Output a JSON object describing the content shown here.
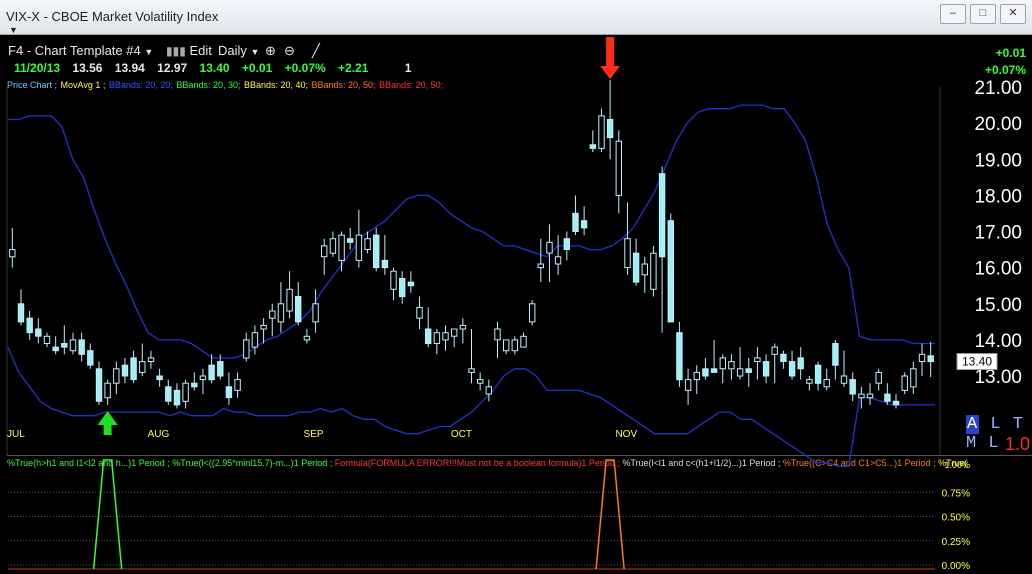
{
  "window": {
    "title": "VIX-X  -  CBOE Market Volatility Index"
  },
  "toolbar": {
    "template": "F4 - Chart Template #4",
    "edit": "Edit",
    "period": "Daily"
  },
  "quote": {
    "date": "11/20/13",
    "open": "13.56",
    "high": "13.94",
    "low": "12.97",
    "close": "13.40",
    "change": "+0.01",
    "pct": "+0.07%",
    "extra": "+2.21",
    "count": "1"
  },
  "right_change": {
    "abs": "+0.01",
    "pct": "+0.07%"
  },
  "price_tag": "13.40",
  "legend": [
    {
      "text": "Price Chart ; ",
      "color": "#66ccff"
    },
    {
      "text": "MovAvg 1 ; ",
      "color": "#ffff33"
    },
    {
      "text": "BBands: 20, 20; ",
      "color": "#3355ff"
    },
    {
      "text": "BBands: 20, 30; ",
      "color": "#33ff33"
    },
    {
      "text": "BBands: 20, 40; ",
      "color": "#ffff33"
    },
    {
      "text": "BBands: 20, 50; ",
      "color": "#ff7722"
    },
    {
      "text": "BBands: 20, 50; ",
      "color": "#ff3333"
    }
  ],
  "indicators": [
    {
      "text": "%True(h>h1 and l1<l2 and h...)1 Period ; ",
      "color": "#33ff33"
    },
    {
      "text": "%True(l<((2.95*minl15.7)-m...)1 Period ; ",
      "color": "#33ff33"
    },
    {
      "text": "Formula(FORMULA ERROR!!!Must not be a boolean formula)1 Period ; ",
      "color": "#ff3333"
    },
    {
      "text": "%True(l<l1 and c<(h1+l1/2)...)1 Period ; ",
      "color": "#dddddd"
    },
    {
      "text": "%True((C>C4 and C1>C5...)1 Period ; ",
      "color": "#ff7722"
    },
    {
      "text": "%True(",
      "color": "#ffff33"
    }
  ],
  "alt_label": {
    "a": "A",
    "rest": "L T M L"
  },
  "value_1_0": "1.0",
  "chart_data": {
    "type": "candlestick",
    "title": "VIX-X - CBOE Market Volatility Index",
    "y_axis": {
      "ticks": [
        "21.00",
        "20.00",
        "19.00",
        "18.00",
        "17.00",
        "16.00",
        "15.00",
        "14.00",
        "13.00"
      ],
      "ylim": [
        12.0,
        21.5
      ]
    },
    "x_axis_labels": [
      {
        "label": "JUL",
        "index": 0
      },
      {
        "label": "AUG",
        "index": 17
      },
      {
        "label": "SEP",
        "index": 35
      },
      {
        "label": "OCT",
        "index": 52
      },
      {
        "label": "NOV",
        "index": 71
      }
    ],
    "candles": [
      [
        16.3,
        17.1,
        16.0,
        16.5
      ],
      [
        15.0,
        15.4,
        14.4,
        14.5
      ],
      [
        14.6,
        14.8,
        14.0,
        14.2
      ],
      [
        14.3,
        14.6,
        13.9,
        14.1
      ],
      [
        13.9,
        14.2,
        13.8,
        14.1
      ],
      [
        13.8,
        14.1,
        13.6,
        13.7
      ],
      [
        13.9,
        14.4,
        13.6,
        13.8
      ],
      [
        13.7,
        14.2,
        13.6,
        14.0
      ],
      [
        14.0,
        14.2,
        13.4,
        13.6
      ],
      [
        13.7,
        13.9,
        13.2,
        13.3
      ],
      [
        13.2,
        13.4,
        12.2,
        12.3
      ],
      [
        12.4,
        12.9,
        12.2,
        12.8
      ],
      [
        12.8,
        13.4,
        12.5,
        13.2
      ],
      [
        13.3,
        13.5,
        12.8,
        13.0
      ],
      [
        13.5,
        13.7,
        12.8,
        12.9
      ],
      [
        13.1,
        13.9,
        13.0,
        13.4
      ],
      [
        13.4,
        13.7,
        13.2,
        13.5
      ],
      [
        13.0,
        13.2,
        12.7,
        12.9
      ],
      [
        12.7,
        12.9,
        12.2,
        12.3
      ],
      [
        12.6,
        12.8,
        12.1,
        12.2
      ],
      [
        12.3,
        12.9,
        12.1,
        12.8
      ],
      [
        12.8,
        13.1,
        12.6,
        12.7
      ],
      [
        12.9,
        13.2,
        12.5,
        13.0
      ],
      [
        13.3,
        13.6,
        12.8,
        12.9
      ],
      [
        13.4,
        13.6,
        12.9,
        13.0
      ],
      [
        12.7,
        13.1,
        12.2,
        12.4
      ],
      [
        12.6,
        13.1,
        12.4,
        12.9
      ],
      [
        13.5,
        14.2,
        13.4,
        14.0
      ],
      [
        13.8,
        14.4,
        13.6,
        14.2
      ],
      [
        14.3,
        14.6,
        13.9,
        14.4
      ],
      [
        14.6,
        15.0,
        14.1,
        14.8
      ],
      [
        14.5,
        15.6,
        14.2,
        15.0
      ],
      [
        14.8,
        15.9,
        14.6,
        15.4
      ],
      [
        15.2,
        15.6,
        14.4,
        14.5
      ],
      [
        14.0,
        14.3,
        13.9,
        14.1
      ],
      [
        14.5,
        15.4,
        14.2,
        15.0
      ],
      [
        16.3,
        16.8,
        15.8,
        16.6
      ],
      [
        16.4,
        17.0,
        16.3,
        16.8
      ],
      [
        16.2,
        17.0,
        15.9,
        16.9
      ],
      [
        16.8,
        17.1,
        16.5,
        16.7
      ],
      [
        16.2,
        17.6,
        16.0,
        16.9
      ],
      [
        16.5,
        17.0,
        16.4,
        16.8
      ],
      [
        16.9,
        17.1,
        15.9,
        16.0
      ],
      [
        16.2,
        16.9,
        15.8,
        16.0
      ],
      [
        15.4,
        16.0,
        15.1,
        15.9
      ],
      [
        15.7,
        15.9,
        15.0,
        15.2
      ],
      [
        15.6,
        15.9,
        15.3,
        15.5
      ],
      [
        14.6,
        15.2,
        14.3,
        14.9
      ],
      [
        14.3,
        14.9,
        13.8,
        13.9
      ],
      [
        13.9,
        14.3,
        13.6,
        14.2
      ],
      [
        14.0,
        14.4,
        13.7,
        14.2
      ],
      [
        14.1,
        14.3,
        13.8,
        14.3
      ],
      [
        14.3,
        14.6,
        13.9,
        14.4
      ],
      [
        13.1,
        14.3,
        12.8,
        13.2
      ],
      [
        12.8,
        13.1,
        12.6,
        12.9
      ],
      [
        12.5,
        12.9,
        12.3,
        12.7
      ],
      [
        14.0,
        14.5,
        13.5,
        14.3
      ],
      [
        13.7,
        14.0,
        13.6,
        14.0
      ],
      [
        13.7,
        14.1,
        13.6,
        14.0
      ],
      [
        13.8,
        14.2,
        13.8,
        14.1
      ],
      [
        14.5,
        15.1,
        14.4,
        15.0
      ],
      [
        16.0,
        16.8,
        15.6,
        16.1
      ],
      [
        16.4,
        17.2,
        15.6,
        16.7
      ],
      [
        16.1,
        16.9,
        15.8,
        16.3
      ],
      [
        16.8,
        17.0,
        16.2,
        16.5
      ],
      [
        17.5,
        18.0,
        16.9,
        17.0
      ],
      [
        17.3,
        17.7,
        16.9,
        17.1
      ],
      [
        19.4,
        19.8,
        19.2,
        19.3
      ],
      [
        19.3,
        20.4,
        19.2,
        20.2
      ],
      [
        20.1,
        21.2,
        19.0,
        19.6
      ],
      [
        18.0,
        19.8,
        17.5,
        19.5
      ],
      [
        16.0,
        17.8,
        15.8,
        16.8
      ],
      [
        16.4,
        16.8,
        15.5,
        15.6
      ],
      [
        15.8,
        16.3,
        15.3,
        16.1
      ],
      [
        15.4,
        16.6,
        15.2,
        16.4
      ],
      [
        18.6,
        18.8,
        14.2,
        16.3
      ],
      [
        17.3,
        17.5,
        14.5,
        14.5
      ],
      [
        14.2,
        14.5,
        12.7,
        12.9
      ],
      [
        12.6,
        13.2,
        12.2,
        12.9
      ],
      [
        12.9,
        13.3,
        12.5,
        13.1
      ],
      [
        13.2,
        13.5,
        12.9,
        13.0
      ],
      [
        13.2,
        14.0,
        13.1,
        13.1
      ],
      [
        13.2,
        13.6,
        12.8,
        13.5
      ],
      [
        13.2,
        13.6,
        12.9,
        13.4
      ],
      [
        13.0,
        13.8,
        12.9,
        13.2
      ],
      [
        13.2,
        13.5,
        12.7,
        13.1
      ],
      [
        13.4,
        13.8,
        12.9,
        13.5
      ],
      [
        13.4,
        13.6,
        12.8,
        13.0
      ],
      [
        13.6,
        13.9,
        12.8,
        13.8
      ],
      [
        13.6,
        13.7,
        13.2,
        13.4
      ],
      [
        13.4,
        13.7,
        12.9,
        13.0
      ],
      [
        13.5,
        13.8,
        12.9,
        13.2
      ],
      [
        12.8,
        13.0,
        12.6,
        12.9
      ],
      [
        13.3,
        13.4,
        12.6,
        12.8
      ],
      [
        12.7,
        13.2,
        12.6,
        12.9
      ],
      [
        13.9,
        14.0,
        12.9,
        13.3
      ],
      [
        12.8,
        13.7,
        12.7,
        13.0
      ],
      [
        12.9,
        13.1,
        12.3,
        12.5
      ],
      [
        12.4,
        12.7,
        12.1,
        12.5
      ],
      [
        12.4,
        12.8,
        12.2,
        12.5
      ],
      [
        12.8,
        13.2,
        12.6,
        13.1
      ],
      [
        12.5,
        12.8,
        12.2,
        12.3
      ],
      [
        12.3,
        12.5,
        12.1,
        12.2
      ],
      [
        12.6,
        13.1,
        12.5,
        13.0
      ],
      [
        12.7,
        13.4,
        12.5,
        13.2
      ],
      [
        13.4,
        13.9,
        13.0,
        13.6
      ],
      [
        13.56,
        13.94,
        12.97,
        13.4
      ]
    ],
    "bbands": {
      "upper": [
        20.1,
        20.1,
        20.2,
        20.2,
        20.2,
        19.9,
        19.0,
        18.5,
        17.6,
        16.8,
        16.1,
        15.5,
        14.8,
        14.2,
        14.0,
        14.0,
        14.0,
        13.9,
        13.7,
        13.5,
        13.5,
        13.5,
        13.6,
        13.8,
        14.0,
        14.1,
        14.3,
        14.5,
        14.8,
        15.3,
        15.7,
        16.1,
        16.5,
        16.9,
        17.1,
        17.3,
        17.6,
        17.9,
        18.0,
        18.0,
        17.8,
        17.5,
        17.3,
        17.1,
        17.0,
        16.8,
        16.6,
        16.6,
        16.5,
        16.4,
        16.3,
        16.6,
        16.6,
        16.6,
        16.5,
        16.5,
        16.6,
        16.8,
        17.1,
        17.6,
        18.1,
        18.8,
        19.5,
        20.0,
        20.3,
        20.4,
        20.4,
        20.4,
        20.5,
        20.5,
        20.5,
        20.4,
        20.4,
        20.0,
        19.5,
        18.5,
        17.2,
        16.5,
        16.0,
        14.1,
        14.0,
        14.0,
        14.0,
        14.0,
        13.9,
        13.9,
        13.9
      ],
      "lower": [
        13.8,
        13.1,
        12.7,
        12.3,
        12.1,
        12.0,
        11.9,
        11.9,
        11.9,
        12.0,
        12.0,
        12.0,
        12.0,
        12.0,
        12.0,
        11.9,
        12.0,
        11.9,
        11.9,
        11.9,
        12.1,
        12.0,
        12.0,
        11.9,
        11.9,
        11.9,
        11.9,
        12.0,
        12.0,
        12.1,
        12.0,
        12.1,
        11.9,
        11.8,
        11.8,
        11.6,
        11.5,
        11.4,
        11.4,
        11.5,
        11.6,
        11.6,
        11.8,
        12.0,
        12.3,
        12.6,
        13.0,
        13.2,
        13.2,
        13.0,
        12.6,
        12.6,
        12.6,
        12.6,
        12.5,
        12.4,
        12.2,
        12.0,
        11.8,
        11.6,
        11.4,
        11.4,
        11.4,
        11.4,
        11.6,
        11.8,
        12.0,
        12.0,
        11.8,
        11.8,
        11.6,
        11.4,
        11.2,
        11.0,
        10.8,
        10.6,
        10.6,
        10.5,
        10.5,
        12.4,
        12.4,
        12.3,
        12.2,
        12.2,
        12.2,
        12.2,
        12.2
      ]
    },
    "annotations": [
      {
        "type": "arrow-up",
        "color": "#22dd22",
        "candle_index": 11
      },
      {
        "type": "arrow-down",
        "color": "#ff2a1a",
        "candle_index": 69
      }
    ],
    "indicator_pane": {
      "y_ticks": [
        "0.75%",
        "0.50%",
        "0.25%",
        "0.00%"
      ],
      "top_label": "1.00%",
      "spikes": [
        {
          "candle_index": 11,
          "color": "#33ff33"
        },
        {
          "candle_index": 69,
          "color": "#ff7722"
        }
      ]
    }
  }
}
